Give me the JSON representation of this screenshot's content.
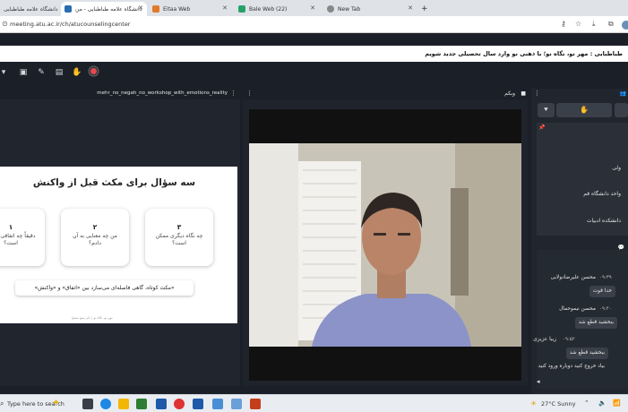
{
  "browser": {
    "tabs": [
      {
        "label": "دانشگاه علامه طباطبایی",
        "active": false
      },
      {
        "label": "دانشگاه علامه طباطبایی - من",
        "active": true
      },
      {
        "label": "Eitaa Web",
        "active": false
      },
      {
        "label": "Bale Web (22)",
        "active": false
      },
      {
        "label": "New Tab",
        "active": false
      }
    ],
    "new_tab_label": "+",
    "url": "meeting.atu.ac.ir/ch/atucounselingcenter"
  },
  "banner": {
    "text": "طباطبایی : مهر نو، نگاه نو؛ با ذهنی نو وارد سال تحصیلی جدید شویم"
  },
  "presentation": {
    "title": "mehr_no_negah_no_workshop_with_emotions_reality",
    "slide": {
      "heading": "سه سؤال برای مکث قبل از واکنش",
      "cards": [
        {
          "num": "۳",
          "text": "چه نگاه دیگری ممکن است؟"
        },
        {
          "num": "۲",
          "text": "من چه معنایی به آن دادم؟"
        },
        {
          "num": "۱",
          "text": "دقیقاً چه اتفاقی افتاده است؟"
        }
      ],
      "quote": "«مکث کوتاه، گاهی فاصله‌ای می‌سازد بین «اتفاق» و «واکنش»",
      "footnote": "مهر نو، نگاه نو | ذکر منبع محتوا"
    }
  },
  "webcam": {
    "title": "وبکم"
  },
  "right_panel": {
    "list_items": [
      "ولی",
      "واحد دانشگاه قم",
      "دانشکده ادبیات"
    ],
    "chat": [
      {
        "time": "۰۹:۳۹",
        "name": "محسن علیرضادولابی",
        "message": "خدا قوت"
      },
      {
        "time": "۰۹:۴۰",
        "name": "محسن نیموحمال",
        "message": "ببخشید قطع شد"
      },
      {
        "time": "۰۹:۵۲",
        "name": "زیبا عزیزی",
        "message": "ببخشید قطع شد"
      }
    ],
    "chat_extra_line": "بیاد خروج کنید دوباره ورود کنید"
  },
  "taskbar": {
    "search_placeholder": "Type here to search",
    "weather_temp": "27°C",
    "weather_text": "Sunny"
  },
  "colors": {
    "app_bg": "#1b2028",
    "panel_bg": "#20252e",
    "accent_red": "#e5484d"
  }
}
